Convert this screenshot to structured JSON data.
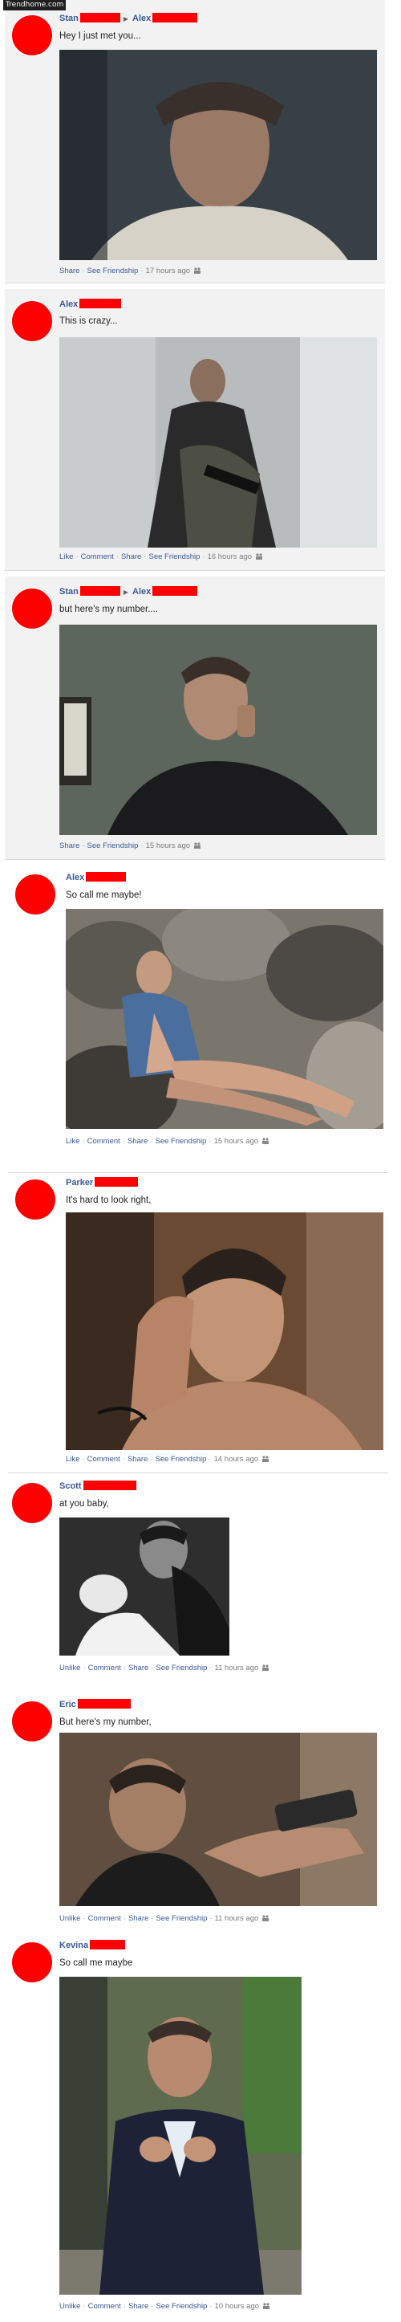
{
  "site_tag": "Trendhome.com",
  "posts": [
    {
      "from": "Stan",
      "to": "Alex",
      "message": "Hey I just met you...",
      "actions": [
        "Share",
        "See Friendship"
      ],
      "time": "17 hours ago"
    },
    {
      "from": "Alex",
      "to": "",
      "message": "This is crazy...",
      "actions": [
        "Like",
        "Comment",
        "Share",
        "See Friendship"
      ],
      "time": "16 hours ago"
    },
    {
      "from": "Stan",
      "to": "Alex",
      "message": "but here's my number....",
      "actions": [
        "Share",
        "See Friendship"
      ],
      "time": "15 hours ago"
    },
    {
      "from": "Alex",
      "to": "",
      "message": "So call me maybe!",
      "actions": [
        "Like",
        "Comment",
        "Share",
        "See Friendship"
      ],
      "time": "15 hours ago"
    },
    {
      "from": "Parker",
      "to": "",
      "message": "It's hard to look right,",
      "actions": [
        "Like",
        "Comment",
        "Share",
        "See Friendship"
      ],
      "time": "14 hours ago"
    },
    {
      "from": "Scott",
      "to": "",
      "message": "at you baby,",
      "actions": [
        "Unlike",
        "Comment",
        "Share",
        "See Friendship"
      ],
      "time": "11 hours ago"
    },
    {
      "from": "Eric",
      "to": "",
      "message": "But here's my number,",
      "actions": [
        "Unlike",
        "Comment",
        "Share",
        "See Friendship"
      ],
      "time": "11 hours ago"
    },
    {
      "from": "Kevina",
      "to": "",
      "message": "So call me maybe",
      "actions": [
        "Unlike",
        "Comment",
        "Share",
        "See Friendship"
      ],
      "time": "10 hours ago"
    }
  ],
  "icons": {
    "arrow": "right-arrow-icon",
    "audience": "people-icon",
    "avatar": "redacted-avatar"
  },
  "colors": {
    "redaction": "#ff0000",
    "link": "#3b5998",
    "background": "#f2f2f2"
  }
}
